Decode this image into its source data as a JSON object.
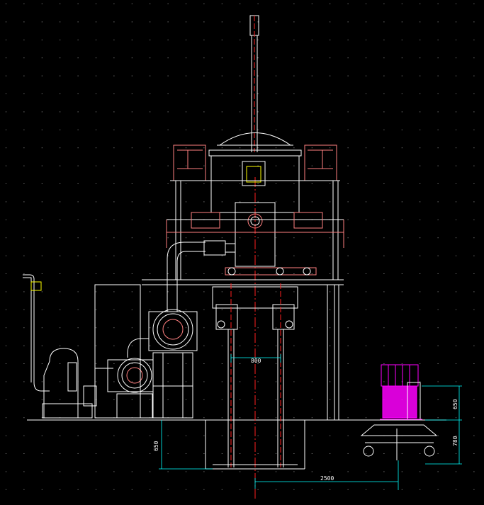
{
  "drawing": {
    "background": "#000000",
    "grid_color": "#9a9a9a",
    "colors": {
      "outline": "#ffffff",
      "centerline": "#ff2020",
      "accent": "#ff8080",
      "cart": "#ff00ff",
      "dimension": "#00ffff",
      "green": "#00ff66",
      "yellow": "#ffff00"
    },
    "dimensions": {
      "width_column": "800",
      "floor_depth": "650",
      "cart_height": "650",
      "cart_base": "780",
      "track_length": "2500"
    }
  }
}
